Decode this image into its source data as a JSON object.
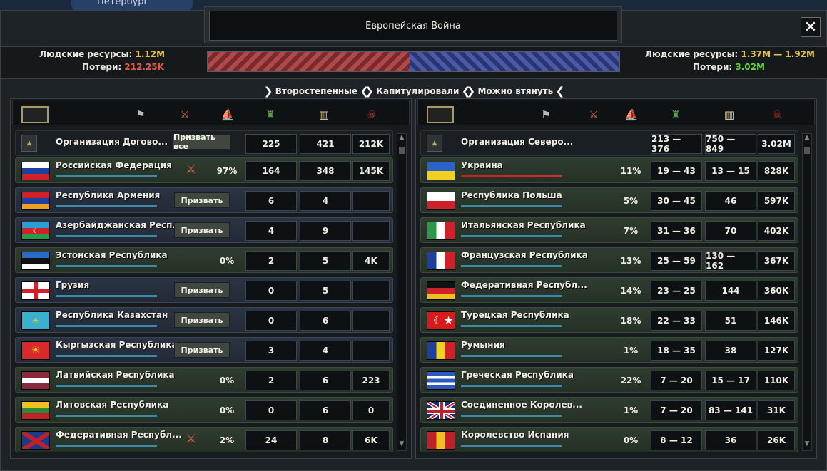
{
  "map": {
    "city_label": "Петербург"
  },
  "window": {
    "title": "Европейская Война",
    "close": "✕"
  },
  "attacker": {
    "manpower_label": "Людские ресурсы:",
    "manpower_value": "1.12M",
    "losses_label": "Потери:",
    "losses_value": "212.25K"
  },
  "defender": {
    "manpower_label": "Людские ресурсы:",
    "manpower_value": "1.37M — 1.92M",
    "losses_label": "Потери:",
    "losses_value": "3.02M"
  },
  "war_score": {
    "attacker_fraction": 0.49
  },
  "filters": [
    "Второстепенные",
    "Капитулировали",
    "Можно втянуть"
  ],
  "header_icons": [
    "white-flag-icon",
    "crossed-swords-icon",
    "naval-icon",
    "army-icon",
    "industry-icon",
    "skull-icon"
  ],
  "colors": {
    "accent_gold": "#e6c24a",
    "loss_red": "#e05a4a",
    "loss_green": "#6cd04a"
  },
  "left": {
    "faction": {
      "name": "Организация Догово...",
      "button": "Призвать все",
      "c1": "225",
      "c2": "421",
      "c3": "212K"
    },
    "rows": [
      {
        "name": "Российская Федерация",
        "flag": "ru",
        "style": "green",
        "war_icon": true,
        "c0": "97%",
        "c1": "164",
        "c2": "348",
        "c3": "145K",
        "bar": 1.0
      },
      {
        "name": "Республика Армения",
        "flag": "am",
        "style": "blue",
        "button": "Призвать",
        "c1": "6",
        "c2": "4",
        "c3": "",
        "bar": 1.0
      },
      {
        "name": "Азербайджанская Респ...",
        "flag": "az",
        "style": "blue",
        "button": "Призвать",
        "c1": "4",
        "c2": "9",
        "c3": "",
        "bar": 1.0
      },
      {
        "name": "Эстонская Республика",
        "flag": "ee",
        "style": "green",
        "c0": "0%",
        "c1": "2",
        "c2": "5",
        "c3": "4K",
        "bar": 1.0
      },
      {
        "name": "Грузия",
        "flag": "ge",
        "style": "blue",
        "button": "Призвать",
        "c1": "0",
        "c2": "5",
        "c3": "",
        "bar": 1.0
      },
      {
        "name": "Республика Казахстан",
        "flag": "kz",
        "style": "blue",
        "button": "Призвать",
        "c1": "0",
        "c2": "6",
        "c3": "",
        "bar": 1.0
      },
      {
        "name": "Кыргызская Республика",
        "flag": "kg",
        "style": "blue",
        "button": "Призвать",
        "c1": "3",
        "c2": "4",
        "c3": "",
        "bar": 1.0
      },
      {
        "name": "Латвийская Республика",
        "flag": "lv",
        "style": "green",
        "c0": "0%",
        "c1": "2",
        "c2": "6",
        "c3": "223",
        "bar": 1.0
      },
      {
        "name": "Литовская Республика",
        "flag": "lt",
        "style": "green",
        "c0": "0%",
        "c1": "0",
        "c2": "6",
        "c3": "0",
        "bar": 1.0
      },
      {
        "name": "Федеративная Республ...",
        "flag": "nr",
        "style": "green",
        "war_icon": true,
        "c0": "2%",
        "c1": "24",
        "c2": "8",
        "c3": "6K",
        "bar": 1.0
      }
    ]
  },
  "right": {
    "faction": {
      "name": "Организация Северо...",
      "c1": "213 — 376",
      "c2": "750 — 849",
      "c3": "3.02M"
    },
    "rows": [
      {
        "name": "Украина",
        "flag": "ua",
        "style": "green",
        "c0": "11%",
        "c1": "19 — 43",
        "c2": "13 — 15",
        "c3": "828K",
        "bar": 1.0,
        "bar_red": true
      },
      {
        "name": "Республика Польша",
        "flag": "pl",
        "style": "green",
        "c0": "5%",
        "c1": "30 — 45",
        "c2": "46",
        "c3": "597K",
        "bar": 1.0
      },
      {
        "name": "Итальянская Республика",
        "flag": "it",
        "style": "green",
        "c0": "7%",
        "c1": "31 — 36",
        "c2": "70",
        "c3": "402K",
        "bar": 1.0
      },
      {
        "name": "Французская Республика",
        "flag": "fr",
        "style": "green",
        "c0": "13%",
        "c1": "25 — 59",
        "c2": "130 — 162",
        "c3": "367K",
        "bar": 1.0
      },
      {
        "name": "Федеративная Республ...",
        "flag": "de",
        "style": "green",
        "c0": "14%",
        "c1": "23 — 25",
        "c2": "144",
        "c3": "360K",
        "bar": 1.0
      },
      {
        "name": "Турецкая Республика",
        "flag": "tr",
        "style": "green",
        "c0": "18%",
        "c1": "22 — 33",
        "c2": "51",
        "c3": "146K",
        "bar": 1.0
      },
      {
        "name": "Румыния",
        "flag": "ro",
        "style": "green",
        "c0": "1%",
        "c1": "18 — 35",
        "c2": "38",
        "c3": "127K",
        "bar": 1.0
      },
      {
        "name": "Греческая Республика",
        "flag": "gr",
        "style": "green",
        "c0": "22%",
        "c1": "7 — 20",
        "c2": "15 — 17",
        "c3": "110K",
        "bar": 1.0
      },
      {
        "name": "Соединенное Королев...",
        "flag": "gb",
        "style": "green",
        "c0": "1%",
        "c1": "7 — 20",
        "c2": "83 — 141",
        "c3": "31K",
        "bar": 1.0
      },
      {
        "name": "Королевство Испания",
        "flag": "es",
        "style": "green",
        "c0": "0%",
        "c1": "8 — 12",
        "c2": "36",
        "c3": "26K",
        "bar": 1.0
      }
    ]
  }
}
